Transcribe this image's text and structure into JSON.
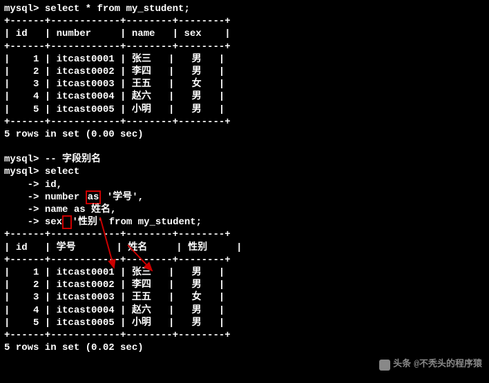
{
  "prompt": "mysql>",
  "cont": "    ->",
  "query1": "select * from my_student;",
  "border": "+------+------------+--------+--------+",
  "header1": "| id   | number     | name   | sex    |",
  "rows1": [
    "|    1 | itcast0001 | 张三   |   男   |",
    "|    2 | itcast0002 | 李四   |   男   |",
    "|    3 | itcast0003 | 王五   |   女   |",
    "|    4 | itcast0004 | 赵六   |   男   |",
    "|    5 | itcast0005 | 小明   |   男   |"
  ],
  "result1": "5 rows in set (0.00 sec)",
  "comment": "-- 字段别名",
  "query2_lines": {
    "l1": "select",
    "l2": "id,",
    "l3a": "number ",
    "l3_as": "as",
    "l3b": " '学号',",
    "l4": "name as 姓名,",
    "l5a": "sex",
    "l5_empty": " ",
    "l5b": "'性别' from my_student;"
  },
  "header2": {
    "id": "id",
    "xuehao": "学号",
    "xingming": "姓名",
    "xingbie": "性别"
  },
  "rows2": [
    "|    1 | itcast0001 | 张三   |   男   |",
    "|    2 | itcast0002 | 李四   |   男   |",
    "|    3 | itcast0003 | 王五   |   女   |",
    "|    4 | itcast0004 | 赵六   |   男   |",
    "|    5 | itcast0005 | 小明   |   男   |"
  ],
  "result2": "5 rows in set (0.02 sec)",
  "watermark_text": "@不秃头的程序猿",
  "watermark_prefix": "头条"
}
